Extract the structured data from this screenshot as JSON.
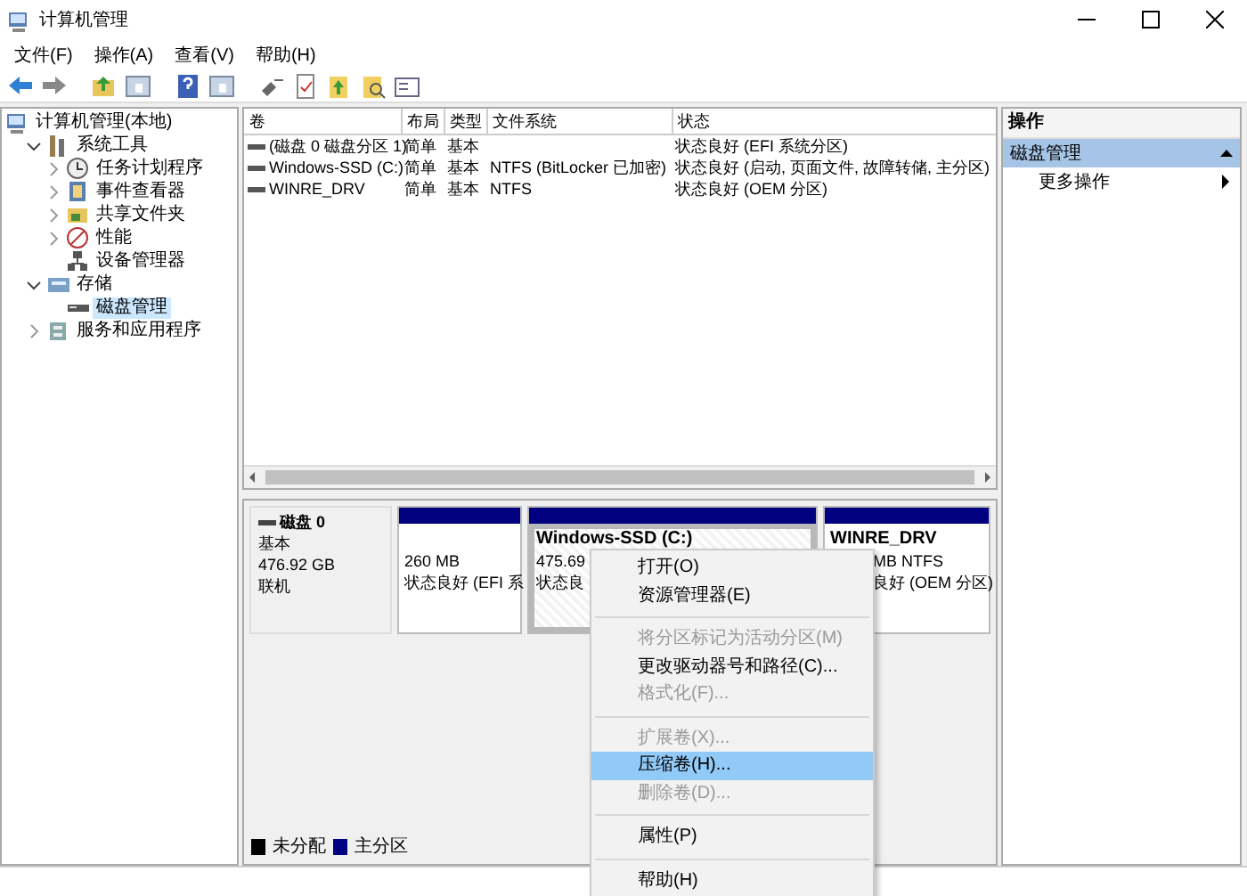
{
  "window": {
    "title": "计算机管理"
  },
  "menu_bar": [
    "文件(F)",
    "操作(A)",
    "查看(V)",
    "帮助(H)"
  ],
  "tree": [
    {
      "label": "计算机管理(本地)",
      "kind": "computer",
      "selected": false,
      "children": [
        {
          "label": "系统工具",
          "kind": "tools",
          "expanded": true,
          "selected": false,
          "children": [
            {
              "label": "任务计划程序",
              "kind": "clock",
              "expanded": false,
              "selected": false
            },
            {
              "label": "事件查看器",
              "kind": "log",
              "expanded": false,
              "selected": false
            },
            {
              "label": "共享文件夹",
              "kind": "share",
              "expanded": false,
              "selected": false
            },
            {
              "label": "性能",
              "kind": "perf",
              "expanded": false,
              "selected": false
            },
            {
              "label": "设备管理器",
              "kind": "device",
              "selected": false
            }
          ]
        },
        {
          "label": "存储",
          "kind": "storage",
          "expanded": true,
          "selected": false,
          "children": [
            {
              "label": "磁盘管理",
              "kind": "disk",
              "selected": true
            }
          ]
        },
        {
          "label": "服务和应用程序",
          "kind": "services",
          "expanded": false,
          "selected": false
        }
      ]
    }
  ],
  "volume_table": {
    "columns": [
      "卷",
      "布局",
      "类型",
      "文件系统",
      "状态"
    ],
    "rows": [
      {
        "volume": "(磁盘 0 磁盘分区 1)",
        "layout": "简单",
        "type": "基本",
        "status": "状态良好 (EFI 系统分区)"
      },
      {
        "volume": "Windows-SSD (C:)",
        "layout": "简单",
        "type": "基本",
        "filesystem": "NTFS (BitLocker 已加密)",
        "status": "状态良好 (启动, 页面文件, 故障转储, 主分区)"
      },
      {
        "volume": "WINRE_DRV",
        "layout": "简单",
        "type": "基本",
        "filesystem": "NTFS",
        "status": "状态良好 (OEM 分区)"
      }
    ]
  },
  "disk": {
    "name": "磁盘 0",
    "type": "基本",
    "size": "476.92 GB",
    "state": "联机",
    "partitions": [
      {
        "lines": [
          "260 MB",
          "状态良好 (EFI 系"
        ],
        "selected": false
      },
      {
        "title": "Windows-SSD (C:)",
        "lines": [
          "475.69",
          "状态良"
        ],
        "selected": true
      },
      {
        "title": "WINRE_DRV",
        "lines": [
          "MB NTFS",
          "良好 (OEM 分区)"
        ],
        "selected": false
      }
    ]
  },
  "legend": [
    {
      "label": "未分配",
      "color": "#000000"
    },
    {
      "label": "主分区",
      "color": "#000080"
    }
  ],
  "actions": {
    "header": "操作",
    "section": "磁盘管理",
    "items": [
      "更多操作"
    ]
  },
  "context_menu": [
    {
      "kind": "item",
      "label": "打开(O)",
      "disabled": false,
      "selected": false
    },
    {
      "kind": "item",
      "label": "资源管理器(E)",
      "disabled": false,
      "selected": false
    },
    {
      "kind": "separator"
    },
    {
      "kind": "item",
      "label": "将分区标记为活动分区(M)",
      "disabled": true,
      "selected": false
    },
    {
      "kind": "item",
      "label": "更改驱动器号和路径(C)...",
      "disabled": false,
      "selected": false
    },
    {
      "kind": "item",
      "label": "格式化(F)...",
      "disabled": true,
      "selected": false
    },
    {
      "kind": "separator"
    },
    {
      "kind": "item",
      "label": "扩展卷(X)...",
      "disabled": true,
      "selected": false
    },
    {
      "kind": "item",
      "label": "压缩卷(H)...",
      "disabled": false,
      "selected": true
    },
    {
      "kind": "item",
      "label": "删除卷(D)...",
      "disabled": true,
      "selected": false
    },
    {
      "kind": "separator"
    },
    {
      "kind": "item",
      "label": "属性(P)",
      "disabled": false,
      "selected": false
    },
    {
      "kind": "separator"
    },
    {
      "kind": "item",
      "label": "帮助(H)",
      "disabled": false,
      "selected": false
    }
  ]
}
